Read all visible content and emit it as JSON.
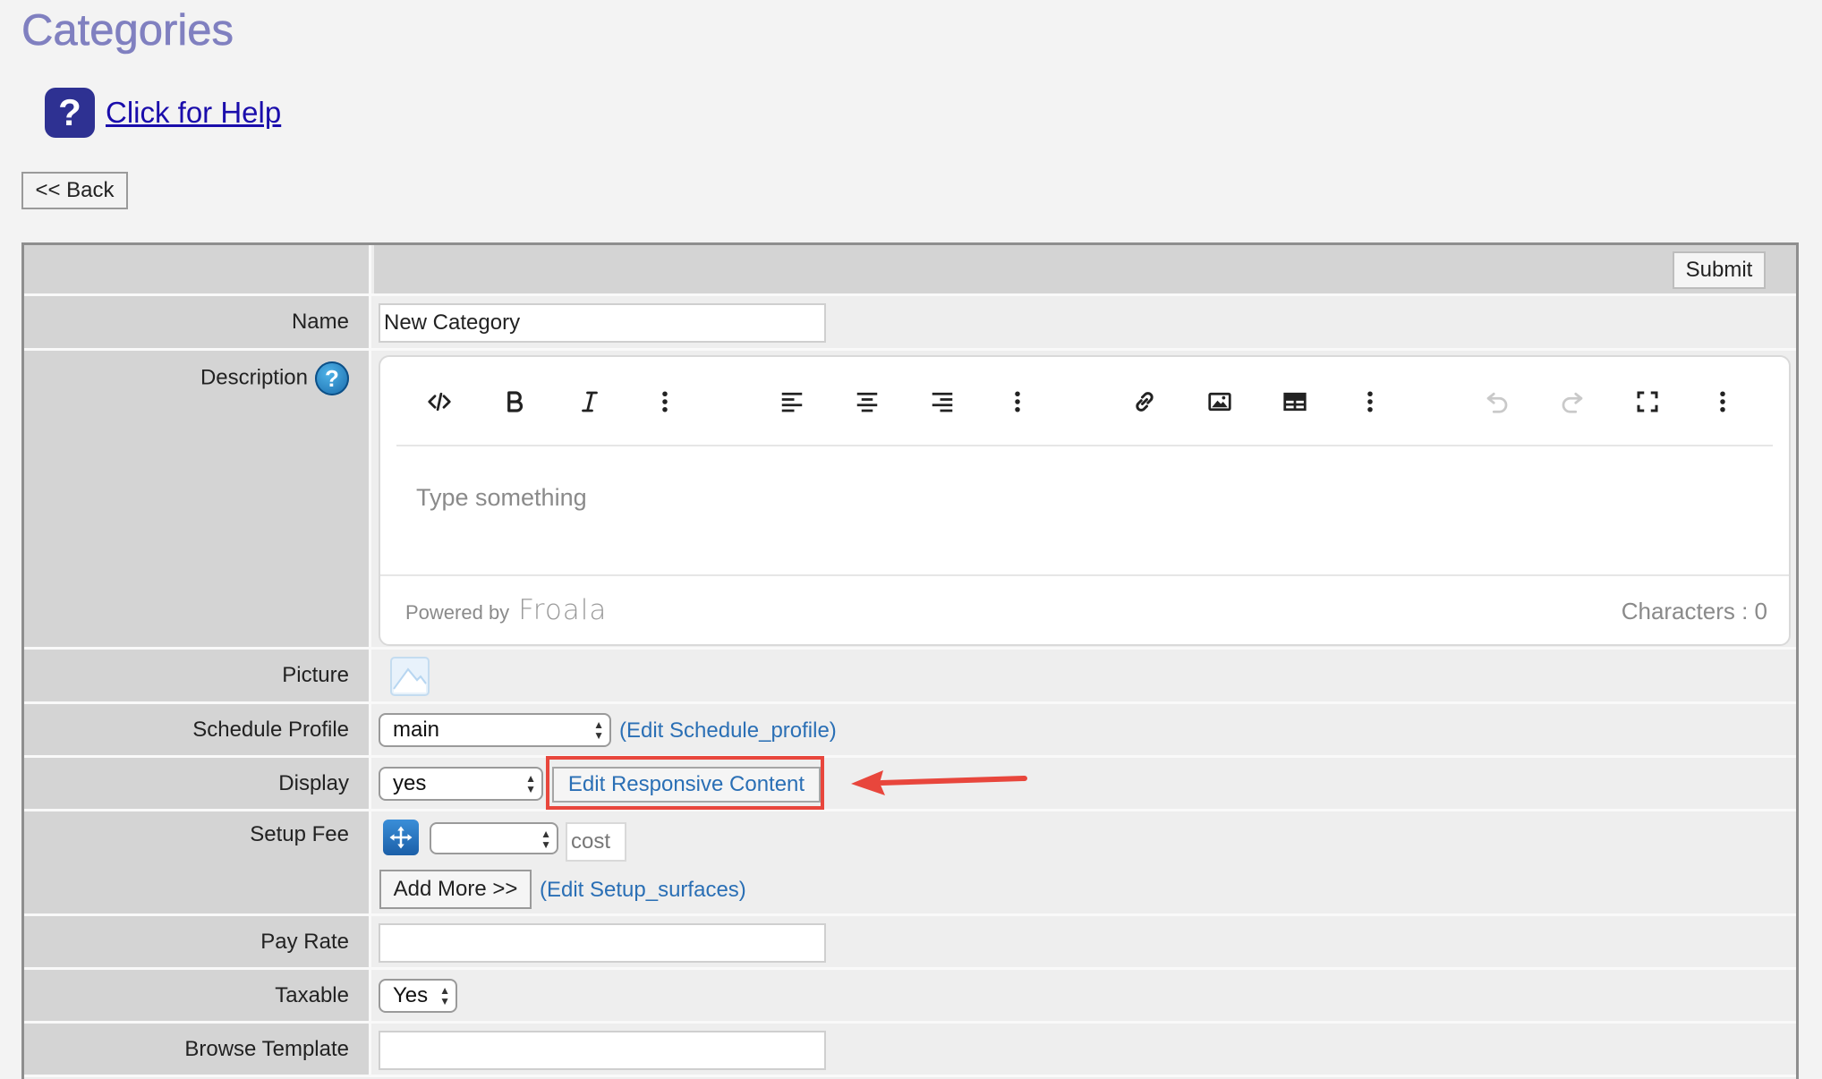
{
  "page": {
    "title": "Categories",
    "help_link": "Click for Help",
    "help_badge": "?",
    "back_label": "<< Back"
  },
  "form": {
    "submit_label": "Submit",
    "name": {
      "label": "Name",
      "value": "New Category"
    },
    "description": {
      "label": "Description",
      "help_icon": "?",
      "placeholder": "Type something",
      "powered_by": "Powered by",
      "brand": "Froala",
      "char_count": "Characters : 0",
      "toolbar": [
        {
          "name": "code-view-icon"
        },
        {
          "name": "bold-icon"
        },
        {
          "name": "italic-icon"
        },
        {
          "name": "more-text-icon"
        },
        {
          "name": "align-left-icon"
        },
        {
          "name": "align-center-icon"
        },
        {
          "name": "align-right-icon"
        },
        {
          "name": "more-paragraph-icon"
        },
        {
          "name": "link-icon"
        },
        {
          "name": "image-icon"
        },
        {
          "name": "table-icon"
        },
        {
          "name": "more-rich-icon"
        },
        {
          "name": "undo-icon"
        },
        {
          "name": "redo-icon"
        },
        {
          "name": "fullscreen-icon"
        },
        {
          "name": "more-misc-icon"
        }
      ]
    },
    "picture": {
      "label": "Picture"
    },
    "schedule_profile": {
      "label": "Schedule Profile",
      "selected": "main",
      "edit_link": "(Edit Schedule_profile)"
    },
    "display": {
      "label": "Display",
      "selected": "yes",
      "edit_button": "Edit Responsive Content"
    },
    "setup_fee": {
      "label": "Setup Fee",
      "selected": "",
      "cost_placeholder": "cost",
      "add_more": "Add More >>",
      "edit_link": "(Edit Setup_surfaces)"
    },
    "pay_rate": {
      "label": "Pay Rate",
      "value": ""
    },
    "taxable": {
      "label": "Taxable",
      "selected": "Yes"
    },
    "browse_template": {
      "label": "Browse Template",
      "value": ""
    }
  },
  "colors": {
    "title": "#8080c0",
    "link": "#1a0dab",
    "edit_link": "#2a6fb5",
    "annotation": "#e8463c",
    "label_cell": "#d4d4d4"
  }
}
